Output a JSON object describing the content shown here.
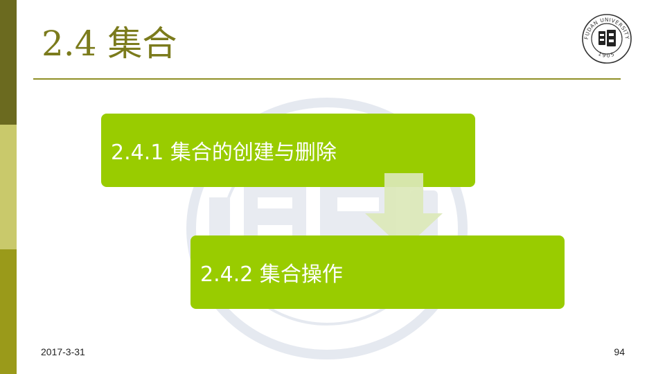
{
  "slide": {
    "title": "2.4 集合",
    "steps": [
      {
        "label": "2.4.1 集合的创建与删除"
      },
      {
        "label": "2.4.2 集合操作"
      }
    ],
    "footer": {
      "date": "2017-3-31",
      "page_number": "94"
    }
  },
  "logo": {
    "text": "FUDAN UNIVERSITY",
    "year": "1905"
  },
  "colors": {
    "accent": "#7b7b1c",
    "box_fill": "#99cc00",
    "arrow_fill": "#dbe8b8",
    "bar_dark": "#6b6a1f",
    "bar_light": "#c9c96b",
    "bar_mid": "#9a9a1a"
  }
}
